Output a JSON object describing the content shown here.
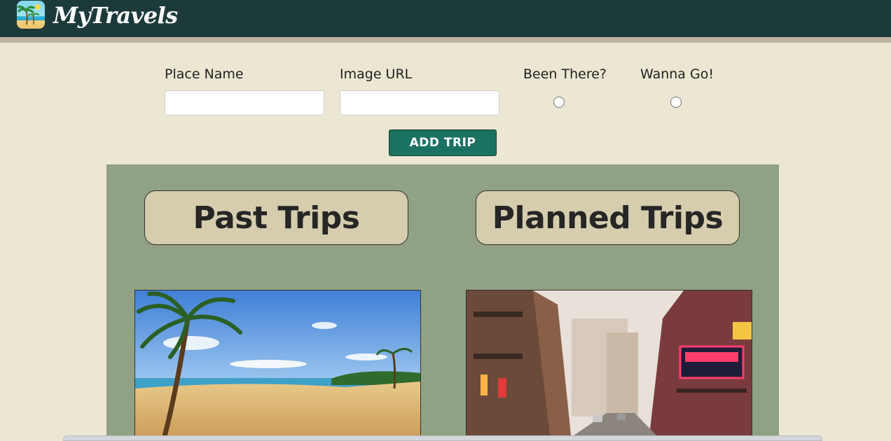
{
  "header": {
    "brand": "MyTravels",
    "logo_icon": "palm-beach-icon"
  },
  "form": {
    "place_name_label": "Place Name",
    "place_name_value": "",
    "image_url_label": "Image URL",
    "image_url_value": "",
    "been_there_label": "Been There?",
    "wanna_go_label": "Wanna Go!",
    "add_button_label": "ADD TRIP"
  },
  "trips": {
    "past_heading": "Past Trips",
    "planned_heading": "Planned Trips",
    "past_card": {
      "image": "tropical-beach-photo"
    },
    "planned_card": {
      "image": "city-street-photo"
    }
  },
  "colors": {
    "header_bg": "#1d3a3a",
    "page_bg": "#ebe7d2",
    "panel_bg": "#91a183",
    "heading_bg": "#d5cdad",
    "button_bg": "#1c7262"
  }
}
